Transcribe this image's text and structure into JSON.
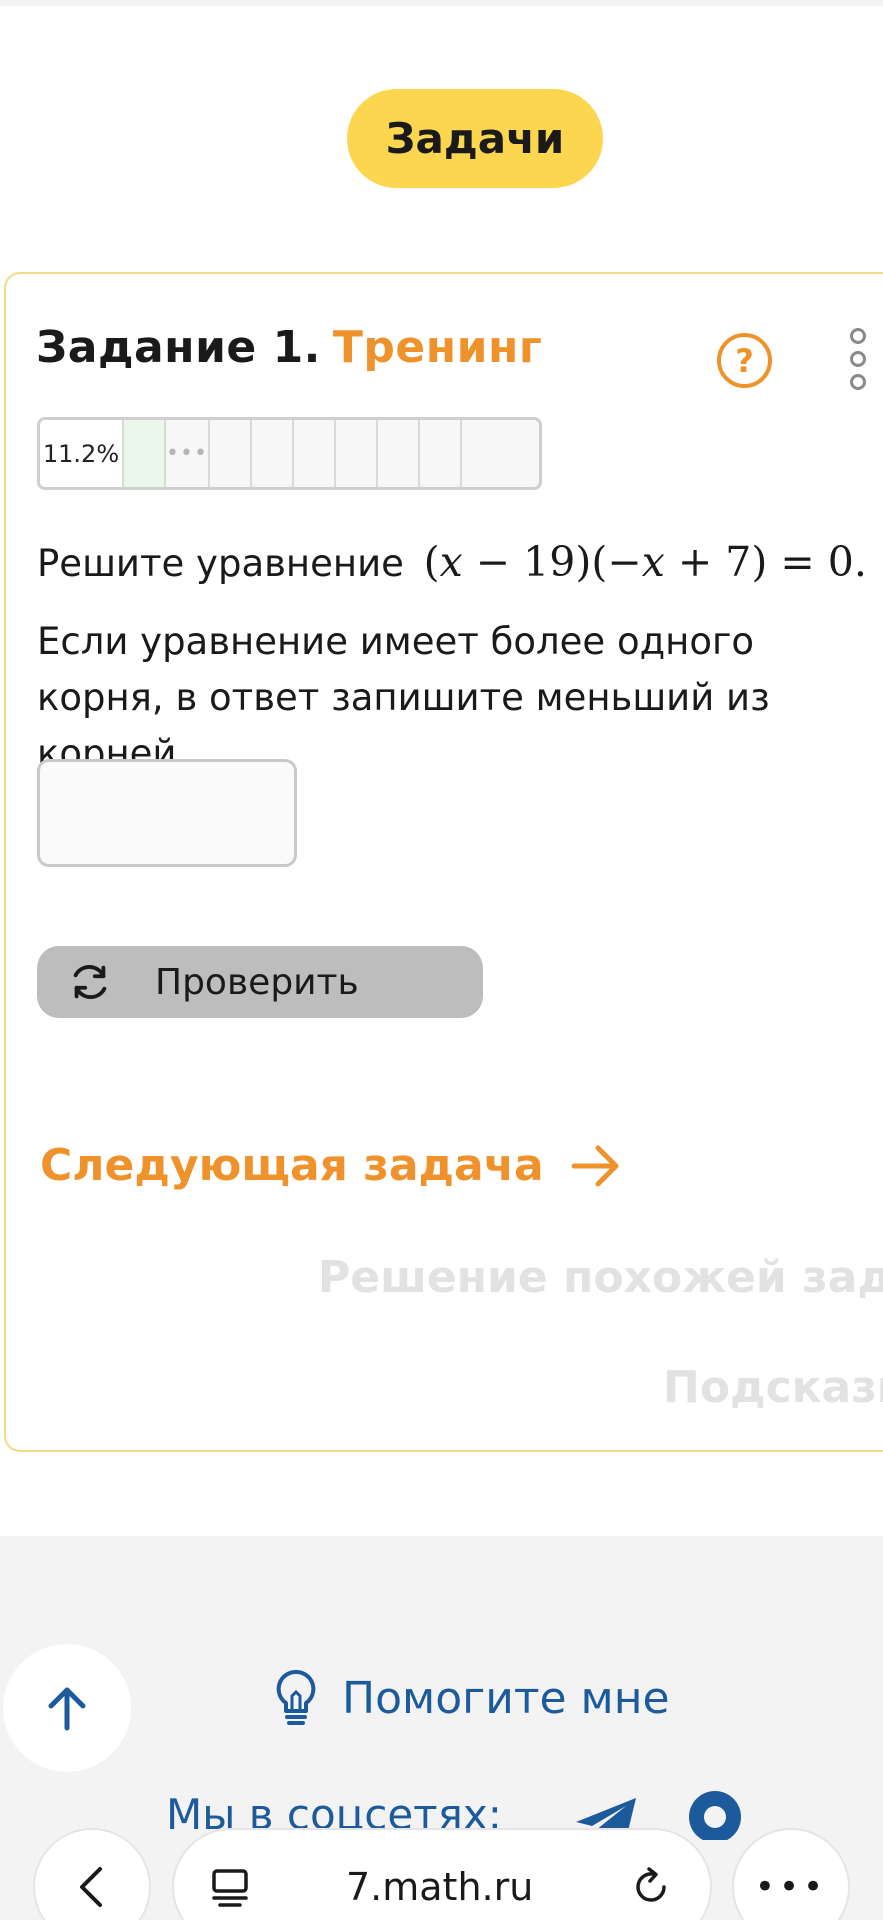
{
  "header": {
    "tasks_button": "Задачи"
  },
  "task": {
    "title_number": "Задание 1.",
    "title_kind": "Тренинг",
    "help_symbol": "?",
    "progress": {
      "percent_label": "11.2%",
      "fraction": 0.112,
      "dots": "•••"
    },
    "problem_prefix": "Решите уравнение",
    "equation": {
      "lhs1": "(",
      "x1": "x",
      "mid1": " − 19)(−",
      "x2": "x",
      "mid2": " + 7) = 0."
    },
    "instruction": "Если уравнение имеет более одного корня, в ответ запишите меньший из корней.",
    "answer": {
      "value": "",
      "placeholder": ""
    },
    "check_label": "Проверить",
    "next_label": "Следующая задача",
    "similar_label": "Решение похожей задачи",
    "hint_label": "Подсказка"
  },
  "footer": {
    "help_me_label": "Помогите мне",
    "social_label": "Мы в соцсетях:"
  },
  "browser": {
    "url": "7.math.ru",
    "more_label": "•••"
  },
  "colors": {
    "accent_orange": "#f0922b",
    "pill_yellow": "#fdd64f",
    "link_blue": "#1d5a9c",
    "button_gray": "#bdbdbd"
  },
  "icons": [
    "help-icon",
    "menu-dots-icon",
    "refresh-icon",
    "arrow-right-icon",
    "arrow-up-icon",
    "bulb-icon",
    "telegram-icon",
    "chat-icon",
    "chevron-left-icon",
    "reader-icon",
    "reload-icon"
  ]
}
